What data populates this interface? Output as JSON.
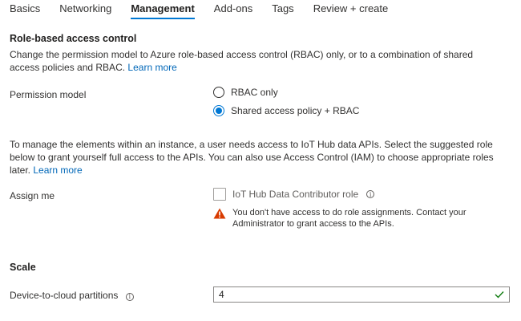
{
  "tabs": [
    {
      "label": "Basics",
      "active": false
    },
    {
      "label": "Networking",
      "active": false
    },
    {
      "label": "Management",
      "active": true
    },
    {
      "label": "Add-ons",
      "active": false
    },
    {
      "label": "Tags",
      "active": false
    },
    {
      "label": "Review + create",
      "active": false
    }
  ],
  "rbac": {
    "title": "Role-based access control",
    "description": "Change the permission model to Azure role-based access control (RBAC) only, or to a combination of shared access policies and RBAC.",
    "learn_more": "Learn more",
    "permission_label": "Permission model",
    "options": [
      {
        "label": "RBAC only",
        "selected": false
      },
      {
        "label": "Shared access policy + RBAC",
        "selected": true
      }
    ]
  },
  "assign": {
    "description": "To manage the elements within an instance, a user needs access to IoT Hub data APIs. Select the suggested role below to grant yourself full access to the APIs. You can also use Access Control (IAM) to choose appropriate roles later.",
    "learn_more": "Learn more",
    "label": "Assign me",
    "checkbox_label": "IoT Hub Data Contributor role",
    "checked": false,
    "warning": "You don't have access to do role assignments. Contact your Administrator to grant access to the APIs."
  },
  "scale": {
    "title": "Scale",
    "partitions_label": "Device-to-cloud partitions",
    "partitions_value": "4"
  },
  "colors": {
    "accent": "#0078d4",
    "link": "#0067b8",
    "warning": "#d83b01",
    "valid": "#107c10"
  }
}
